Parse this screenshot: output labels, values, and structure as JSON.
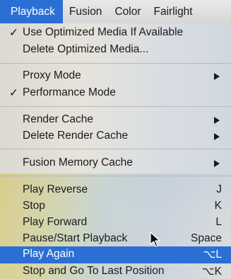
{
  "menubar": {
    "items": [
      {
        "label": "Playback"
      },
      {
        "label": "Fusion"
      },
      {
        "label": "Color"
      },
      {
        "label": "Fairlight"
      }
    ]
  },
  "menu": {
    "items": [
      {
        "label": "Use Optimized Media If Available",
        "checked": "✓"
      },
      {
        "label": "Delete Optimized Media..."
      },
      {
        "label": "Proxy Mode"
      },
      {
        "label": "Performance Mode",
        "checked": "✓"
      },
      {
        "label": "Render Cache"
      },
      {
        "label": "Delete Render Cache"
      },
      {
        "label": "Fusion Memory Cache"
      },
      {
        "label": "Play Reverse",
        "shortcut": "J"
      },
      {
        "label": "Stop",
        "shortcut": "K"
      },
      {
        "label": "Play Forward",
        "shortcut": "L"
      },
      {
        "label": "Pause/Start Playback",
        "shortcut": "Space"
      },
      {
        "label": "Play Again",
        "shortcut": "⌥L"
      },
      {
        "label": "Stop and Go To Last Position",
        "shortcut": "⌥K"
      }
    ]
  },
  "colors": {
    "highlight": "#2b6fd4",
    "menubar": "#e0e0e0",
    "text": "#1b1b1b"
  },
  "icons": {
    "submenu": "submenu-arrow-icon",
    "check": "checkmark-icon",
    "cursor": "mouse-pointer-icon"
  }
}
